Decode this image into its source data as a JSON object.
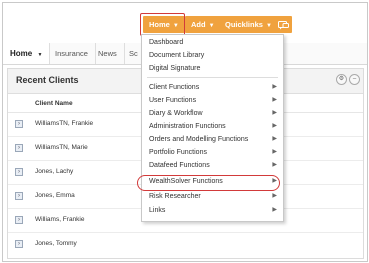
{
  "toolbar": {
    "home_label": "Home",
    "add_label": "Add",
    "quicklinks_label": "Quicklinks",
    "chat_icon": "chat-icon",
    "accent_color": "#f0a23e",
    "highlight_color": "#d23a3a"
  },
  "tabs": [
    {
      "label": "Home"
    },
    {
      "label": "Insurance"
    },
    {
      "label": "News"
    },
    {
      "label": "Sc"
    }
  ],
  "panel": {
    "title": "Recent Clients",
    "column_header": "Client Name",
    "clients": [
      {
        "name": "WilliamsTN, Frankie"
      },
      {
        "name": "WilliamsTN, Marie"
      },
      {
        "name": "Jones, Lachy"
      },
      {
        "name": "Jones, Emma"
      },
      {
        "name": "Williams, Frankie"
      },
      {
        "name": "Jones, Tommy"
      }
    ]
  },
  "menu": {
    "top_items": [
      {
        "label": "Dashboard"
      },
      {
        "label": "Document Library"
      },
      {
        "label": "Digital Signature"
      }
    ],
    "function_items": [
      {
        "label": "Client Functions"
      },
      {
        "label": "User Functions"
      },
      {
        "label": "Diary & Workflow"
      },
      {
        "label": "Administration Functions"
      },
      {
        "label": "Orders and Modelling Functions"
      },
      {
        "label": "Portfolio Functions"
      },
      {
        "label": "Datafeed Functions"
      },
      {
        "label": "WealthSolver Functions"
      },
      {
        "label": "Risk Researcher"
      },
      {
        "label": "Links"
      }
    ]
  }
}
